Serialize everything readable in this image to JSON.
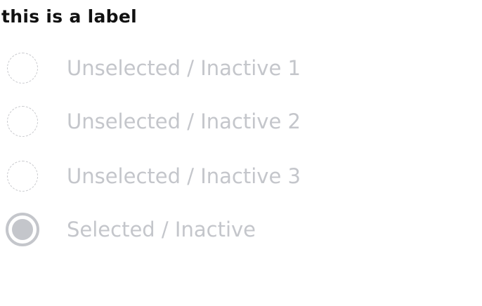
{
  "radio_group": {
    "label": "this is a label",
    "options": [
      {
        "label": "Unselected / Inactive 1",
        "selected": false
      },
      {
        "label": "Unselected / Inactive 2",
        "selected": false
      },
      {
        "label": "Unselected / Inactive 3",
        "selected": false
      },
      {
        "label": "Selected / Inactive",
        "selected": true
      }
    ]
  },
  "colors": {
    "label_text": "#111111",
    "inactive_text": "#c4c6cb",
    "inactive_border": "#c8c9cd"
  },
  "icons": {
    "unselected": "radio-unselected-icon",
    "selected": "radio-selected-icon"
  }
}
